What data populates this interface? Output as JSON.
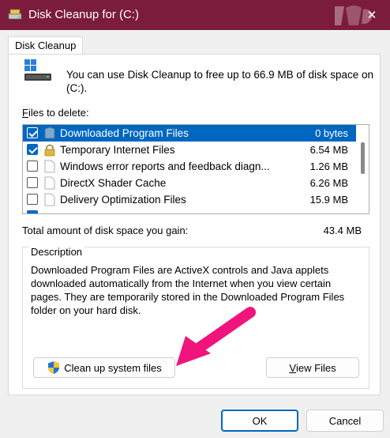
{
  "window": {
    "title": "Disk Cleanup for  (C:)",
    "close_glyph": "✕"
  },
  "tab": {
    "label": "Disk Cleanup"
  },
  "info": {
    "text": "You can use Disk Cleanup to free up to 66.9 MB of disk space on (C:)."
  },
  "files": {
    "label_underlined": "F",
    "label_rest": "iles to delete:",
    "items": [
      {
        "name": "Downloaded Program Files",
        "size": "0 bytes",
        "checked": true,
        "selected": true
      },
      {
        "name": "Temporary Internet Files",
        "size": "6.54 MB",
        "checked": true,
        "selected": false
      },
      {
        "name": "Windows error reports and feedback diagn...",
        "size": "1.26 MB",
        "checked": false,
        "selected": false
      },
      {
        "name": "DirectX Shader Cache",
        "size": "6.26 MB",
        "checked": false,
        "selected": false
      },
      {
        "name": "Delivery Optimization Files",
        "size": "15.9 MB",
        "checked": false,
        "selected": false
      }
    ]
  },
  "total": {
    "label": "Total amount of disk space you gain:",
    "value": "43.4 MB"
  },
  "description": {
    "legend": "Description",
    "text": "Downloaded Program Files are ActiveX controls and Java applets downloaded automatically from the Internet when you view certain pages. They are temporarily stored in the Downloaded Program Files folder on your hard disk."
  },
  "buttons": {
    "cleanup_label": "Clean up system files",
    "view_underlined": "V",
    "view_rest": "iew Files",
    "ok": "OK",
    "cancel": "Cancel"
  },
  "colors": {
    "titlebar": "#7b1c3c",
    "accent": "#0067c0",
    "annotation_arrow": "#f0147c"
  }
}
